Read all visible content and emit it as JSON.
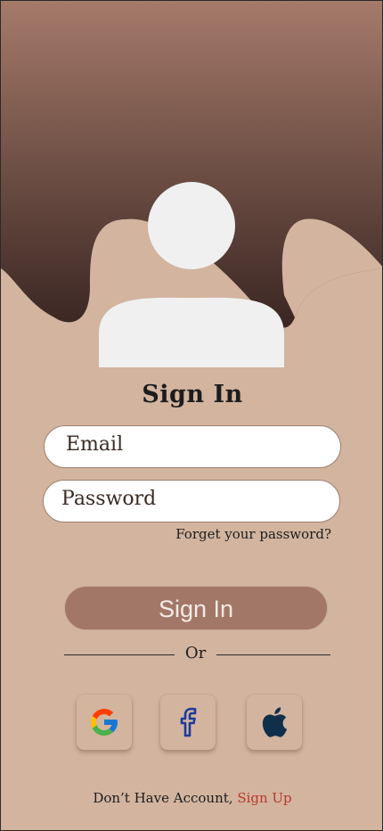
{
  "login": {
    "title": "Sign In",
    "email_placeholder": "Email",
    "password_placeholder": "Password",
    "forgot_password": "Forget your password?",
    "signin_button": "Sign In",
    "or_label": "Or"
  },
  "social": {
    "google_icon": "google-icon",
    "facebook_icon": "facebook-icon",
    "apple_icon": "apple-icon"
  },
  "footer": {
    "prompt": "Don’t Have Account,",
    "signup_link": "Sign Up"
  },
  "colors": {
    "background": "#d3b49f",
    "header_gradient_top": "#a57a6a",
    "header_gradient_bottom": "#3a2622",
    "button": "#a37767",
    "link": "#b83a2c",
    "avatar": "#f0f0f0"
  }
}
